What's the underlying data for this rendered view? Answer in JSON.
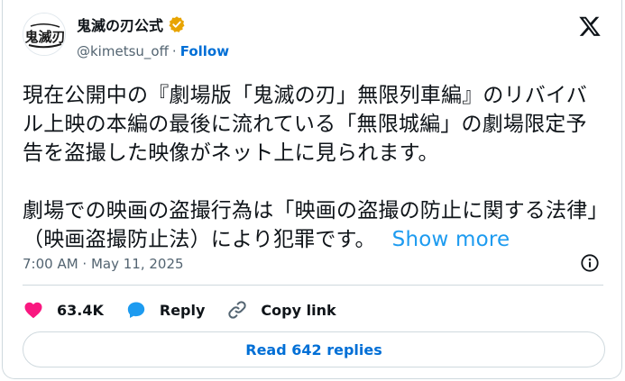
{
  "author": {
    "display_name": "鬼滅の刃公式",
    "handle": "@kimetsu_off",
    "separator": "·",
    "follow_label": "Follow",
    "avatar_icon": "kimetsu-logo-avatar",
    "verified_color": "#e8a400"
  },
  "post": {
    "paragraph1": "現在公開中の『劇場版「鬼滅の刃」無限列車編』のリバイバル上映の本編の最後に流れている「無限城編」の劇場限定予告を盗撮した映像がネット上に見られます。",
    "paragraph2": "劇場での映画の盗撮行為は「映画の盗撮の防止に関する法律」（映画盗撮防止法）により犯罪です。",
    "show_more_label": "Show more",
    "timestamp": "7:00 AM · May 11, 2025"
  },
  "actions": {
    "likes_count": "63.4K",
    "reply_label": "Reply",
    "copy_link_label": "Copy link",
    "like_color": "#f91880",
    "reply_icon_color": "#1d9bf0"
  },
  "replies_button_label": "Read 642 replies"
}
